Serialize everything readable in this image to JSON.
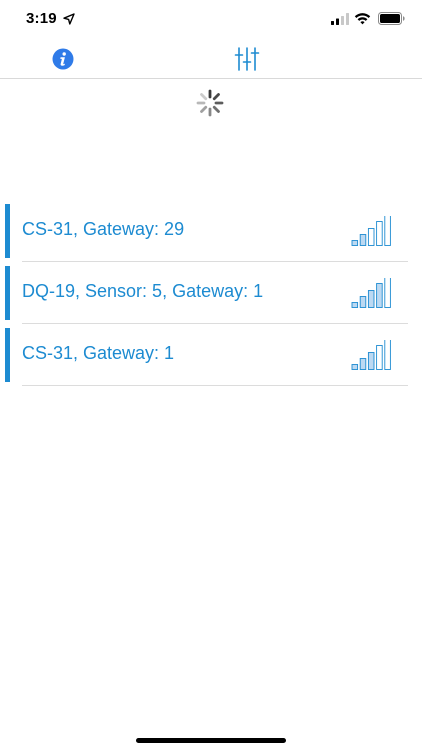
{
  "status_bar": {
    "time": "3:19",
    "icons": [
      "location-arrow-icon",
      "cellular-signal-icon",
      "wifi-icon",
      "battery-icon"
    ]
  },
  "toolbar": {
    "left_icon": "info-icon",
    "center_icon": "sliders-icon"
  },
  "colors": {
    "accent": "#1d8bd1",
    "info_icon": "#2f7be8",
    "divider": "#dcdcdc"
  },
  "loading": {
    "icon": "activity-spinner-icon"
  },
  "devices": [
    {
      "label": "CS-31, Gateway: 29",
      "signal_bars_filled": 2,
      "signal_bars_total": 5
    },
    {
      "label": "DQ-19, Sensor: 5, Gateway: 1",
      "signal_bars_filled": 4,
      "signal_bars_total": 5
    },
    {
      "label": "CS-31, Gateway: 1",
      "signal_bars_filled": 3,
      "signal_bars_total": 5
    }
  ]
}
